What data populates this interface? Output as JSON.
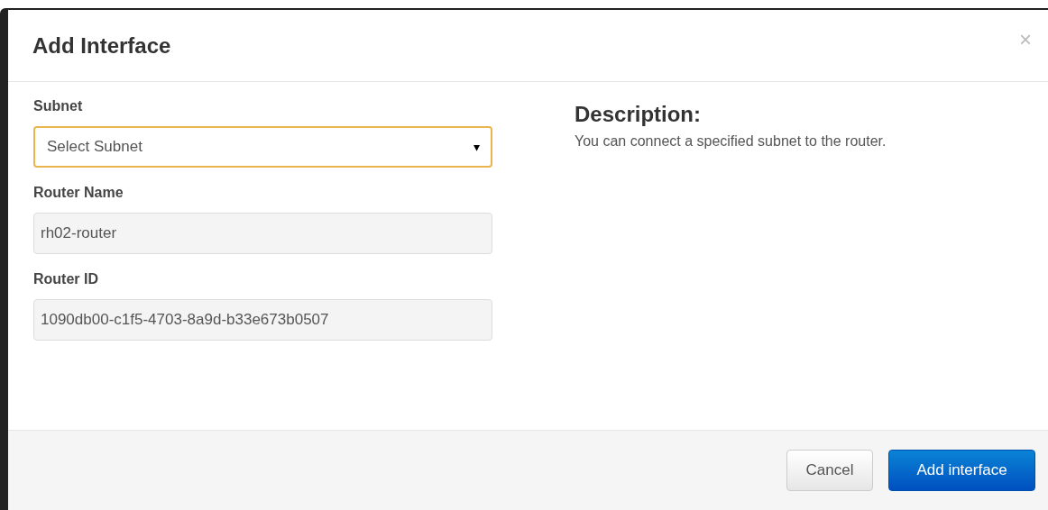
{
  "dialog": {
    "title": "Add Interface",
    "close": "×"
  },
  "fields": [
    {
      "kind": "select",
      "label": "Subnet",
      "placeholder": "Select Subnet",
      "focused": true,
      "caret": "▾"
    },
    {
      "kind": "readonly",
      "label": "Router Name",
      "value": "rh02-router",
      "focused": false
    },
    {
      "kind": "readonly",
      "label": "Router ID",
      "value": "1090db00-c1f5-4703-8a9d-b33e673b0507",
      "focused": false
    }
  ],
  "description": {
    "heading": "Description:",
    "text": "You can connect a specified subnet to the router."
  },
  "buttons": [
    {
      "label": "Cancel",
      "kind": "default"
    },
    {
      "label": "Add interface",
      "kind": "primary"
    }
  ]
}
